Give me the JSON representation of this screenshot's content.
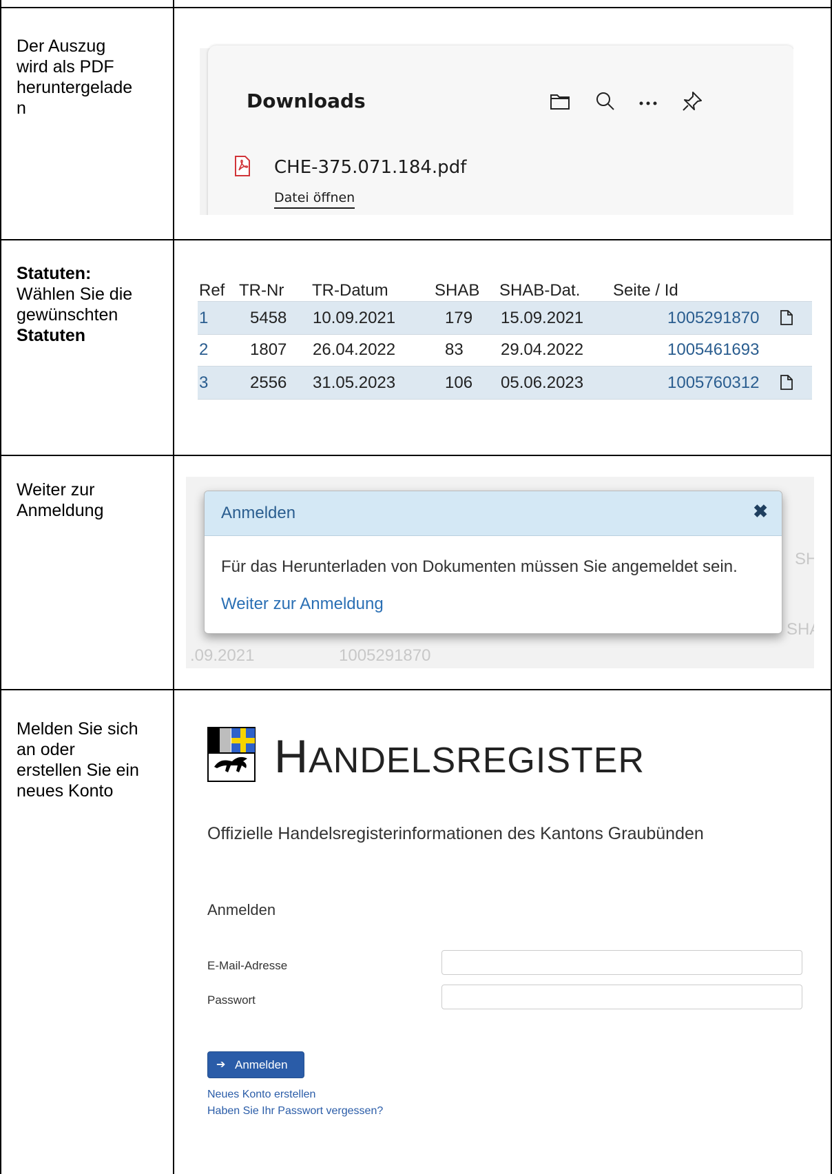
{
  "rows": [
    {
      "instruction": "Der Auszug wird als PDF heruntergelade n",
      "instruction_lines": [
        "Der Auszug",
        "wird als PDF",
        "heruntergelade",
        "n"
      ]
    },
    {
      "instruction_bold_1": "Statuten:",
      "instruction_lines": [
        "Wählen Sie die",
        "gewünschten"
      ],
      "instruction_bold_2": "Statuten"
    },
    {
      "instruction_lines": [
        "Weiter zur",
        "Anmeldung"
      ]
    },
    {
      "instruction_lines": [
        "Melden Sie sich",
        "an oder",
        "erstellen Sie ein",
        "neues Konto"
      ]
    }
  ],
  "downloads": {
    "title": "Downloads",
    "file_name": "CHE-375.071.184.pdf",
    "open_label": "Datei öffnen",
    "icons": [
      "folder-icon",
      "search-icon",
      "more-icon",
      "pin-icon",
      "pdf-file-icon"
    ]
  },
  "statuten_table": {
    "headers": [
      "Ref",
      "TR-Nr",
      "TR-Datum",
      "SHAB",
      "SHAB-Dat.",
      "Seite / Id"
    ],
    "rows": [
      {
        "ref": "1",
        "tr_nr": "5458",
        "tr_datum": "10.09.2021",
        "shab": "179",
        "shab_dat": "15.09.2021",
        "seite_id": "1005291870",
        "has_doc": true
      },
      {
        "ref": "2",
        "tr_nr": "1807",
        "tr_datum": "26.04.2022",
        "shab": "83",
        "shab_dat": "29.04.2022",
        "seite_id": "1005461693",
        "has_doc": false
      },
      {
        "ref": "3",
        "tr_nr": "2556",
        "tr_datum": "31.05.2023",
        "shab": "106",
        "shab_dat": "05.06.2023",
        "seite_id": "1005760312",
        "has_doc": true
      }
    ],
    "shaded_color": "#dde8f1",
    "link_color": "#2a5d8f"
  },
  "modal": {
    "title": "Anmelden",
    "close_glyph": "✖",
    "message": "Für das Herunterladen von Dokumenten müssen Sie angemeldet sein.",
    "link": "Weiter zur Anmeldung",
    "background_fragments": {
      "right_1": "SH",
      "right_2": "SHA",
      "bottom_date": ".09.2021",
      "bottom_id": "1005291870"
    },
    "header_color": "#d4e8f5"
  },
  "login": {
    "brand_initial": "H",
    "brand_rest": "ANDELSREGISTER",
    "subtitle": "Offizielle Handelsregisterinformationen des Kantons Graubünden",
    "heading": "Anmelden",
    "email_label": "E-Mail-Adresse",
    "password_label": "Passwort",
    "email_value": "",
    "password_value": "",
    "submit_label": "Anmelden",
    "submit_icon": "sign-in-icon",
    "create_account": "Neues Konto erstellen",
    "forgot_password": "Haben Sie Ihr Passwort vergessen?",
    "button_color": "#2a5ca8"
  }
}
